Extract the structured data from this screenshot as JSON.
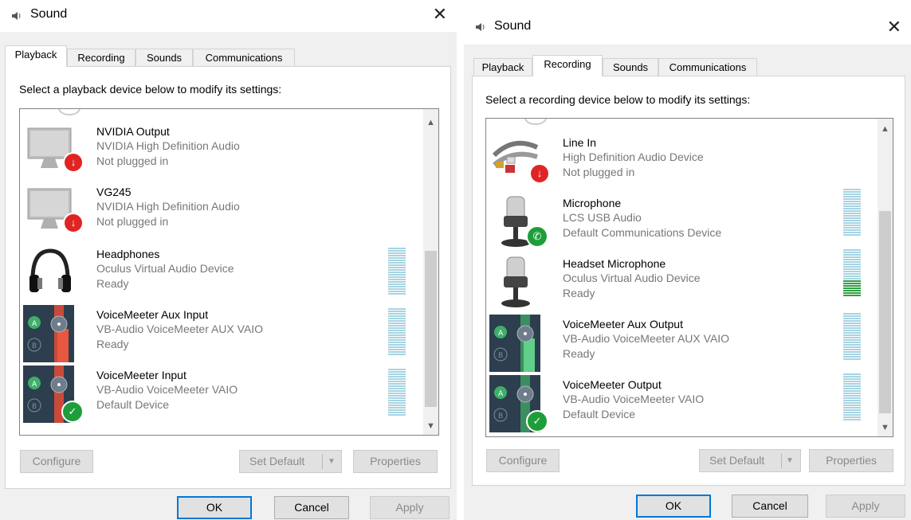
{
  "left": {
    "title": "Sound",
    "close": "✕",
    "tabs": [
      "Playback",
      "Recording",
      "Sounds",
      "Communications"
    ],
    "active_tab": "Playback",
    "prompt": "Select a playback device below to modify its settings:",
    "devices": [
      {
        "name": "NVIDIA Output",
        "driver": "NVIDIA High Definition Audio",
        "status": "Not plugged in",
        "icon": "monitor-icon",
        "badge": "unplugged-badge-icon"
      },
      {
        "name": "VG245",
        "driver": "NVIDIA High Definition Audio",
        "status": "Not plugged in",
        "icon": "monitor-icon",
        "badge": "unplugged-badge-icon"
      },
      {
        "name": "Headphones",
        "driver": "Oculus Virtual Audio Device",
        "status": "Ready",
        "icon": "headphones-icon"
      },
      {
        "name": "VoiceMeeter Aux Input",
        "driver": "VB-Audio VoiceMeeter AUX VAIO",
        "status": "Ready",
        "icon": "voicemeeter-icon"
      },
      {
        "name": "VoiceMeeter Input",
        "driver": "VB-Audio VoiceMeeter VAIO",
        "status": "Default Device",
        "icon": "voicemeeter-icon",
        "badge": "default-check-badge-icon"
      }
    ],
    "buttons": {
      "configure": "Configure",
      "set_default": "Set Default",
      "properties": "Properties",
      "ok": "OK",
      "cancel": "Cancel",
      "apply": "Apply"
    }
  },
  "right": {
    "title": "Sound",
    "close": "✕",
    "tabs": [
      "Playback",
      "Recording",
      "Sounds",
      "Communications"
    ],
    "active_tab": "Recording",
    "prompt": "Select a recording device below to modify its settings:",
    "devices": [
      {
        "name": "Line In",
        "driver": "High Definition Audio Device",
        "status": "Not plugged in",
        "icon": "line-in-cable-icon",
        "badge": "unplugged-badge-icon"
      },
      {
        "name": "Microphone",
        "driver": "LCS USB Audio",
        "status": "Default Communications Device",
        "icon": "microphone-icon",
        "badge": "phone-badge-icon"
      },
      {
        "name": "Headset Microphone",
        "driver": "Oculus Virtual Audio Device",
        "status": "Ready",
        "icon": "microphone-icon"
      },
      {
        "name": "VoiceMeeter Aux Output",
        "driver": "VB-Audio VoiceMeeter AUX VAIO",
        "status": "Ready",
        "icon": "voicemeeter-icon"
      },
      {
        "name": "VoiceMeeter Output",
        "driver": "VB-Audio VoiceMeeter VAIO",
        "status": "Default Device",
        "icon": "voicemeeter-icon",
        "badge": "default-check-badge-icon"
      }
    ],
    "buttons": {
      "configure": "Configure",
      "set_default": "Set Default",
      "properties": "Properties",
      "ok": "OK",
      "cancel": "Cancel",
      "apply": "Apply"
    }
  },
  "colors": {
    "accent": "#0078d7",
    "meter_idle": "#a8d4e2",
    "meter_active": "#2ea043",
    "unplugged": "#e02424",
    "default_ok": "#1e9e3a"
  }
}
